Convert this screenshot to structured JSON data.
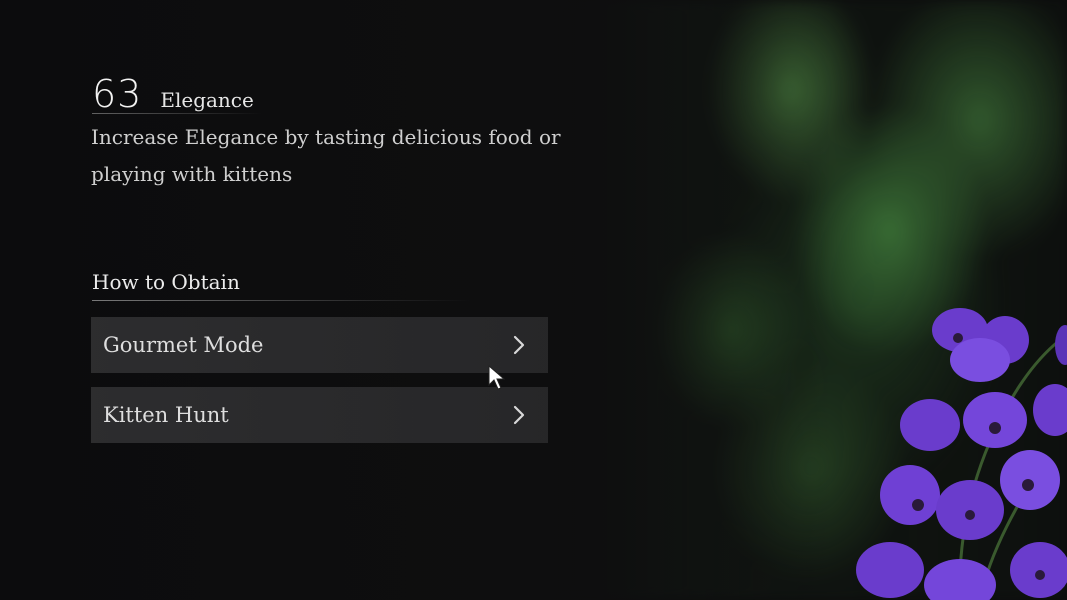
{
  "stat": {
    "value": "63",
    "name": "Elegance",
    "description": "Increase Elegance by tasting delicious food or playing with kittens"
  },
  "obtain": {
    "title": "How to Obtain",
    "items": [
      {
        "label": "Gourmet Mode",
        "icon": "chevron-right-icon"
      },
      {
        "label": "Kitten Hunt",
        "icon": "chevron-right-icon"
      }
    ]
  },
  "colors": {
    "text_primary": "#ececec",
    "text_secondary": "#cfcfcf",
    "item_bg": "#333335",
    "flower_purple": "#6b3fd0",
    "foliage_green": "#3f7a3a"
  }
}
